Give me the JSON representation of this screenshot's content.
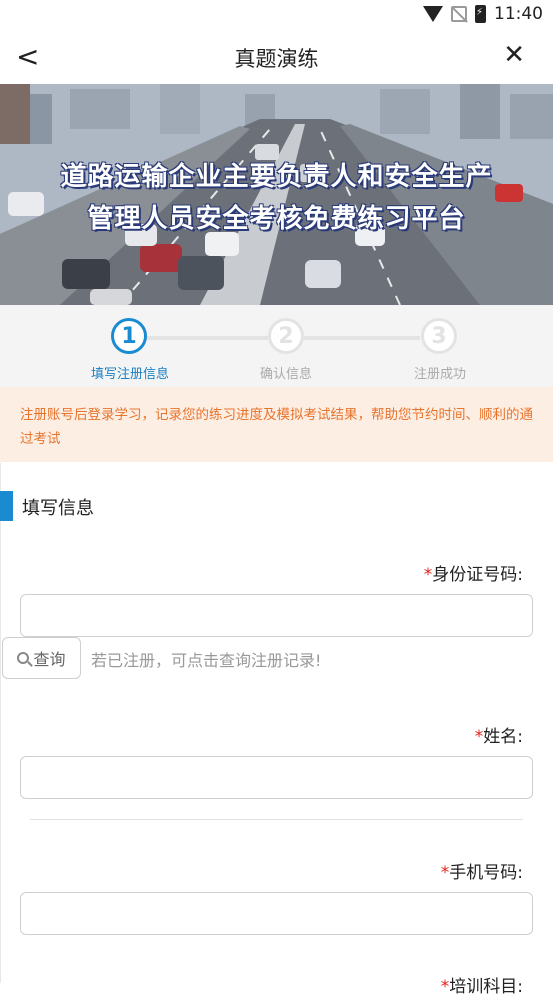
{
  "status": {
    "time": "11:40"
  },
  "nav": {
    "back": "<",
    "title": "真题演练",
    "close": "✕"
  },
  "banner": {
    "line1": "道路运输企业主要负责人和安全生产",
    "line2": "管理人员安全考核免费练习平台"
  },
  "steps": [
    {
      "num": "1",
      "label": "填写注册信息",
      "active": true
    },
    {
      "num": "2",
      "label": "确认信息",
      "active": false
    },
    {
      "num": "3",
      "label": "注册成功",
      "active": false
    }
  ],
  "notice": "注册账号后登录学习，记录您的练习进度及模拟考试结果，帮助您节约时间、顺利的通过考试",
  "section": {
    "title": "填写信息"
  },
  "form": {
    "id_label": "身份证号码:",
    "query_button": "查询",
    "query_hint": "若已注册，可点击查询注册记录!",
    "name_label": "姓名:",
    "phone_label": "手机号码:",
    "subject_label": "培训科目:",
    "required_mark": "*"
  },
  "colors": {
    "accent": "#1a8bd0",
    "notice_bg": "#fdeee3",
    "notice_text": "#e8742c",
    "required": "#e2231a"
  }
}
